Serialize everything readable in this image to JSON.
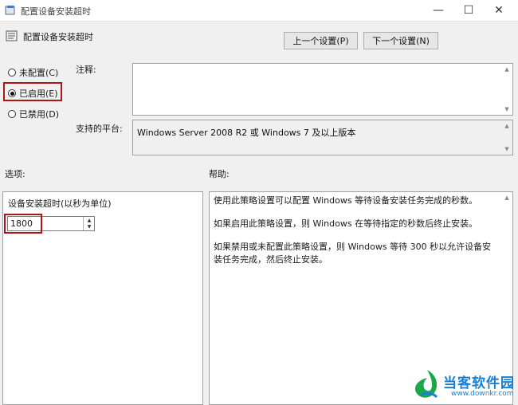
{
  "window": {
    "title": "配置设备安装超时",
    "controls": {
      "minimize": "—",
      "maximize": "☐",
      "close": "✕"
    }
  },
  "header": {
    "setting_name": "配置设备安装超时",
    "prev_button": "上一个设置(P)",
    "next_button": "下一个设置(N)"
  },
  "state": {
    "options": [
      {
        "label": "未配置(C)",
        "selected": false
      },
      {
        "label": "已启用(E)",
        "selected": true
      },
      {
        "label": "已禁用(D)",
        "selected": false
      }
    ]
  },
  "comment": {
    "label": "注释:",
    "value": ""
  },
  "platform": {
    "label": "支持的平台:",
    "value": "Windows Server 2008 R2 或 Windows 7 及以上版本"
  },
  "options_section": {
    "label": "选项:",
    "timeout_label": "设备安装超时(以秒为单位)",
    "timeout_value": "1800"
  },
  "help_section": {
    "label": "帮助:",
    "paragraphs": [
      "使用此策略设置可以配置 Windows 等待设备安装任务完成的秒数。",
      "如果启用此策略设置，则 Windows 在等待指定的秒数后终止安装。",
      "如果禁用或未配置此策略设置，则 Windows 等待 300 秒以允许设备安装任务完成，然后终止安装。"
    ]
  },
  "watermark": {
    "brand": "当客软件园",
    "url": "www.downkr.com"
  },
  "colors": {
    "highlight": "#b0141a",
    "watermark": "#1a7fd0"
  }
}
